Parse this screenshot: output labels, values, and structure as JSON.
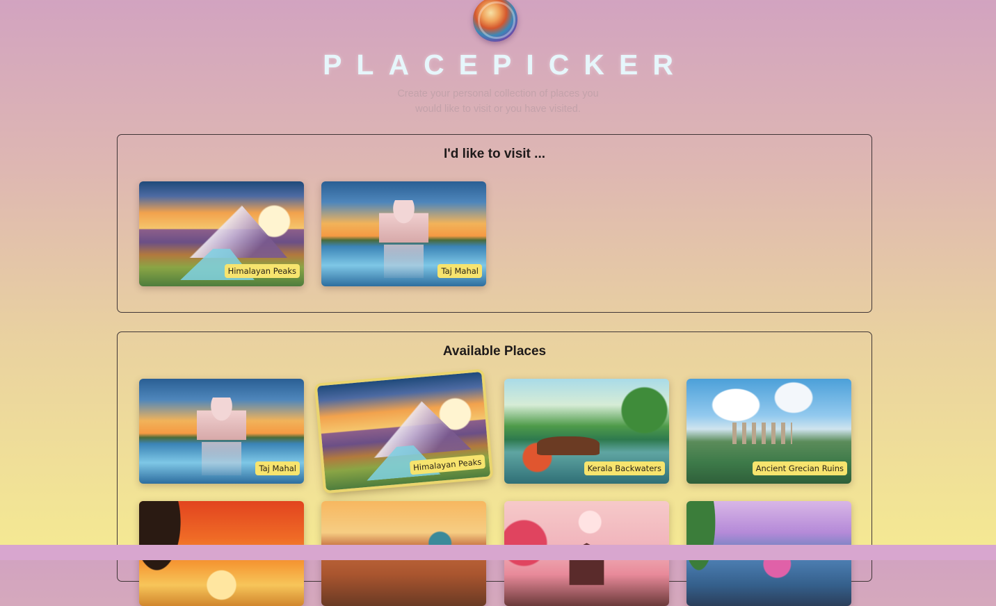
{
  "header": {
    "logo_icon": "globe-logo",
    "title": "PLACEPICKER",
    "subtitle": "Create your personal collection of places you would like to visit or you have visited."
  },
  "picked": {
    "heading": "I'd like to visit ...",
    "places": [
      {
        "title": "Himalayan Peaks",
        "scene": "mountain"
      },
      {
        "title": "Taj Mahal",
        "scene": "taj"
      }
    ]
  },
  "available": {
    "heading": "Available Places",
    "places": [
      {
        "title": "Taj Mahal",
        "scene": "taj"
      },
      {
        "title": "Himalayan Peaks",
        "scene": "mountain"
      },
      {
        "title": "Kerala Backwaters",
        "scene": "kerala"
      },
      {
        "title": "Ancient Grecian Ruins",
        "scene": "grecian"
      },
      {
        "scene": "savanna"
      },
      {
        "scene": "venice"
      },
      {
        "scene": "pagoda"
      },
      {
        "scene": "paris"
      }
    ]
  },
  "colors": {
    "caption_bg": "#f7e46e",
    "title_color": "#e6f6fb",
    "panel_border": "#3f3536"
  }
}
